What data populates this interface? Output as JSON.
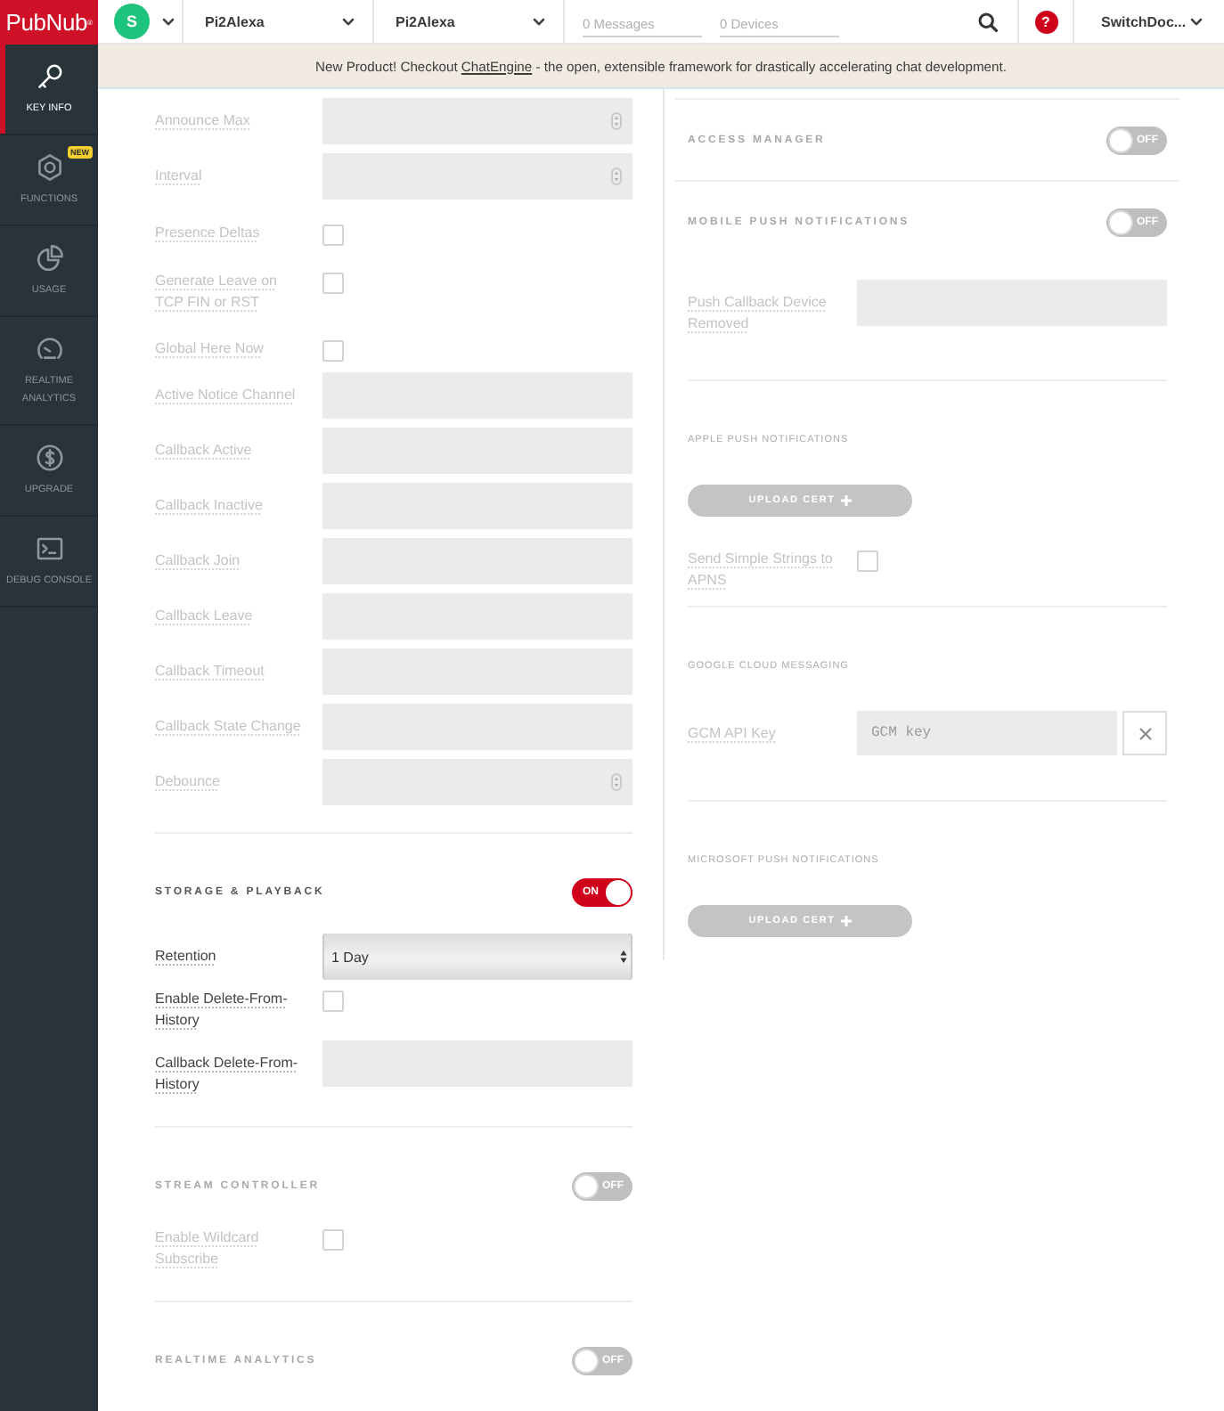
{
  "sidebar": {
    "logo": "PubNub$^{®}$",
    "items": [
      {
        "label": "KEY INFO",
        "selected": true
      },
      {
        "label": "FUNCTIONS",
        "selected": false,
        "badge": "NEW"
      },
      {
        "label": "USAGE",
        "selected": false
      },
      {
        "label": "REALTIME ANALYTICS",
        "selected": false
      },
      {
        "label": "UPGRADE",
        "selected": false
      },
      {
        "label": "DEBUG CONSOLE",
        "selected": false
      }
    ]
  },
  "topbar": {
    "account_initial": "S",
    "selects": [
      "Pi2Alexa",
      "Pi2Alexa"
    ],
    "counters": [
      "0 Messages",
      "0 Devices"
    ],
    "help": "?",
    "user_menu": "SwitchDoc..."
  },
  "banner": {
    "before": "New Product! Checkout ",
    "link": "ChatEngine",
    "after": " - the open, extensible framework for drastically accelerating chat development."
  },
  "left_sections": [
    {
      "on": false,
      "fields": [
        {
          "kind": "number",
          "label": "Announce Max"
        },
        {
          "kind": "number",
          "label": "Interval"
        },
        {
          "kind": "checkbox",
          "label": "Presence Deltas",
          "checked": false
        },
        {
          "kind": "checkbox",
          "label": "Generate Leave on TCP FIN or RST",
          "checked": false
        },
        {
          "kind": "checkbox",
          "label": "Global Here Now",
          "checked": false
        },
        {
          "kind": "text",
          "label": "Active Notice Channel"
        },
        {
          "kind": "text",
          "label": "Callback Active"
        },
        {
          "kind": "text",
          "label": "Callback Inactive"
        },
        {
          "kind": "text",
          "label": "Callback Join"
        },
        {
          "kind": "text",
          "label": "Callback Leave"
        },
        {
          "kind": "text",
          "label": "Callback Timeout"
        },
        {
          "kind": "text",
          "label": "Callback State Change"
        },
        {
          "kind": "number",
          "label": "Debounce"
        }
      ]
    },
    {
      "title": "STORAGE & PLAYBACK",
      "on": true,
      "toggle_label": "ON",
      "fields": [
        {
          "kind": "select",
          "label": "Retention",
          "value": "1 Day"
        },
        {
          "kind": "checkbox",
          "label": "Enable Delete-From-History",
          "checked": false
        },
        {
          "kind": "text",
          "label": "Callback Delete-From-History"
        }
      ]
    },
    {
      "title": "STREAM CONTROLLER",
      "on": false,
      "toggle_label": "OFF",
      "fields": [
        {
          "kind": "checkbox",
          "label": "Enable Wildcard Subscribe",
          "checked": false
        }
      ]
    },
    {
      "title": "REALTIME ANALYTICS",
      "on": false,
      "toggle_label": "OFF"
    }
  ],
  "right_sections": [
    {
      "title": "ACCESS MANAGER",
      "on": false,
      "toggle_label": "OFF"
    },
    {
      "title": "MOBILE PUSH NOTIFICATIONS",
      "on": false,
      "toggle_label": "OFF",
      "fields": [
        {
          "kind": "text",
          "label": "Push Callback Device Removed"
        }
      ],
      "subsections": [
        {
          "title": "APPLE PUSH NOTIFICATIONS",
          "items": [
            {
              "kind": "upload",
              "label": "UPLOAD CERT"
            },
            {
              "kind": "checkbox",
              "label": "Send Simple Strings to APNS",
              "checked": false
            }
          ]
        },
        {
          "title": "GOOGLE CLOUD MESSAGING",
          "items": [
            {
              "kind": "clearable",
              "label": "GCM API Key",
              "placeholder": "GCM key"
            }
          ]
        },
        {
          "title": "MICROSOFT PUSH NOTIFICATIONS",
          "items": [
            {
              "kind": "upload",
              "label": "UPLOAD CERT"
            }
          ]
        }
      ]
    }
  ]
}
